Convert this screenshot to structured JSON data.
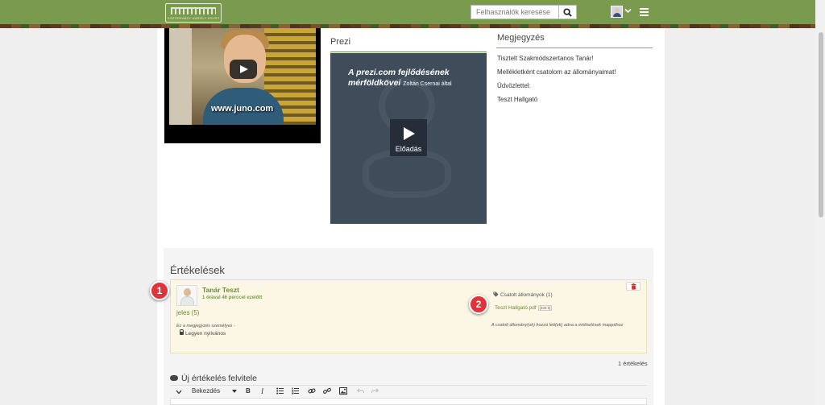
{
  "header": {
    "logo_text": "ESZTERHÁZY KÁROLY EGYETEM",
    "search_placeholder": "Felhasználók keresése",
    "icons": [
      "search-icon",
      "user-avatar-icon",
      "chevron-down-icon",
      "hamburger-menu-icon"
    ]
  },
  "video": {
    "watermark": "www.juno.com",
    "icon": "play-icon"
  },
  "prezi": {
    "label": "Prezi",
    "title": "A prezi.com fejlődésének mérföldkövei",
    "author": "Zoltán Csernai által",
    "play_label": "Előadás"
  },
  "note": {
    "label": "Megjegyzés",
    "lines": [
      "Tisztelt Szakmódszertanos Tanár!",
      "Mellékletként csatolom az állományaimat!",
      "Üdvözlettel:",
      "Teszt Hallgató"
    ]
  },
  "evaluations": {
    "title": "Értékelések",
    "card": {
      "author": "Tanár Teszt",
      "time": "1 órával 46 perccel ezelőtt",
      "grade": "jeles (5)",
      "personal_note": "Ez a megjegyzés személyes -",
      "public_label": "Legyen nyilvános",
      "attachments_label": "Csatolt állományok (1)",
      "file_name": "Teszt Hallgató.pdf",
      "file_size": "[430 b]",
      "attachments_note": "A csatolt állomány(ok) hozzá lett(ek) adva a értékelések mappához"
    },
    "count": "1 értékelés",
    "markers": [
      "1",
      "2"
    ]
  },
  "new_evaluation": {
    "title": "Új értékelés felvitele",
    "format_select": "Bekezdés",
    "bold": "B",
    "italic": "I"
  },
  "colors": {
    "header_green": "#7a9a4e",
    "link_green": "#6b8a36",
    "marker_red": "#e0343c"
  }
}
